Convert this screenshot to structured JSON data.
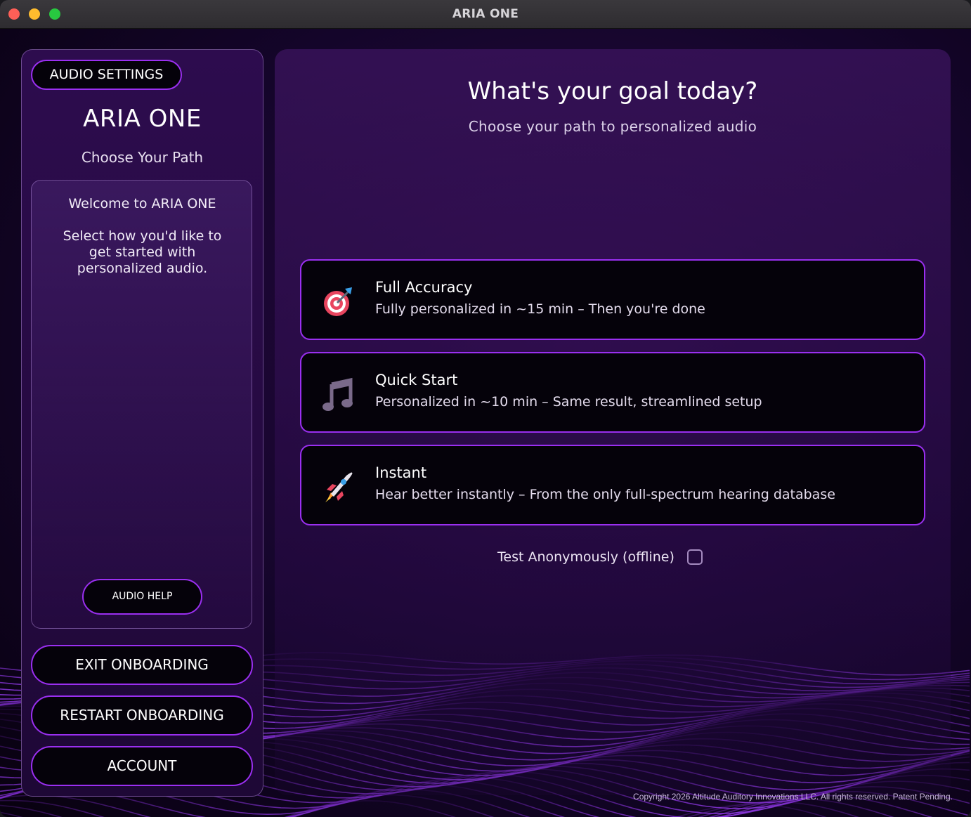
{
  "window": {
    "title": "ARIA ONE"
  },
  "sidebar": {
    "audio_settings_label": "AUDIO SETTINGS",
    "app_name": "ARIA ONE",
    "subtitle": "Choose Your Path",
    "welcome_title": "Welcome to ARIA ONE",
    "welcome_text": "Select how you'd like to get started with personalized audio.",
    "audio_help_label": "AUDIO HELP",
    "exit_label": "EXIT ONBOARDING",
    "restart_label": "RESTART ONBOARDING",
    "account_label": "ACCOUNT"
  },
  "main": {
    "title": "What's your goal today?",
    "subtitle": "Choose your path to personalized audio",
    "options": [
      {
        "icon": "target-dart-icon",
        "title": "Full Accuracy",
        "description": "Fully personalized in ~15 min – Then you're done"
      },
      {
        "icon": "music-note-icon",
        "title": "Quick Start",
        "description": "Personalized in ~10 min – Same result, streamlined setup"
      },
      {
        "icon": "rocket-icon",
        "title": "Instant",
        "description": "Hear better instantly – From the only full-spectrum hearing database"
      }
    ],
    "anonymous_label": "Test Anonymously (offline)",
    "anonymous_checked": false
  },
  "footer": {
    "copyright": "Copyright 2026 Altitude Auditory Innovations LLC. All rights reserved. Patent Pending."
  },
  "colors": {
    "accent": "#9a2ff0",
    "background": "#14052a",
    "button_fill": "#05020a"
  }
}
